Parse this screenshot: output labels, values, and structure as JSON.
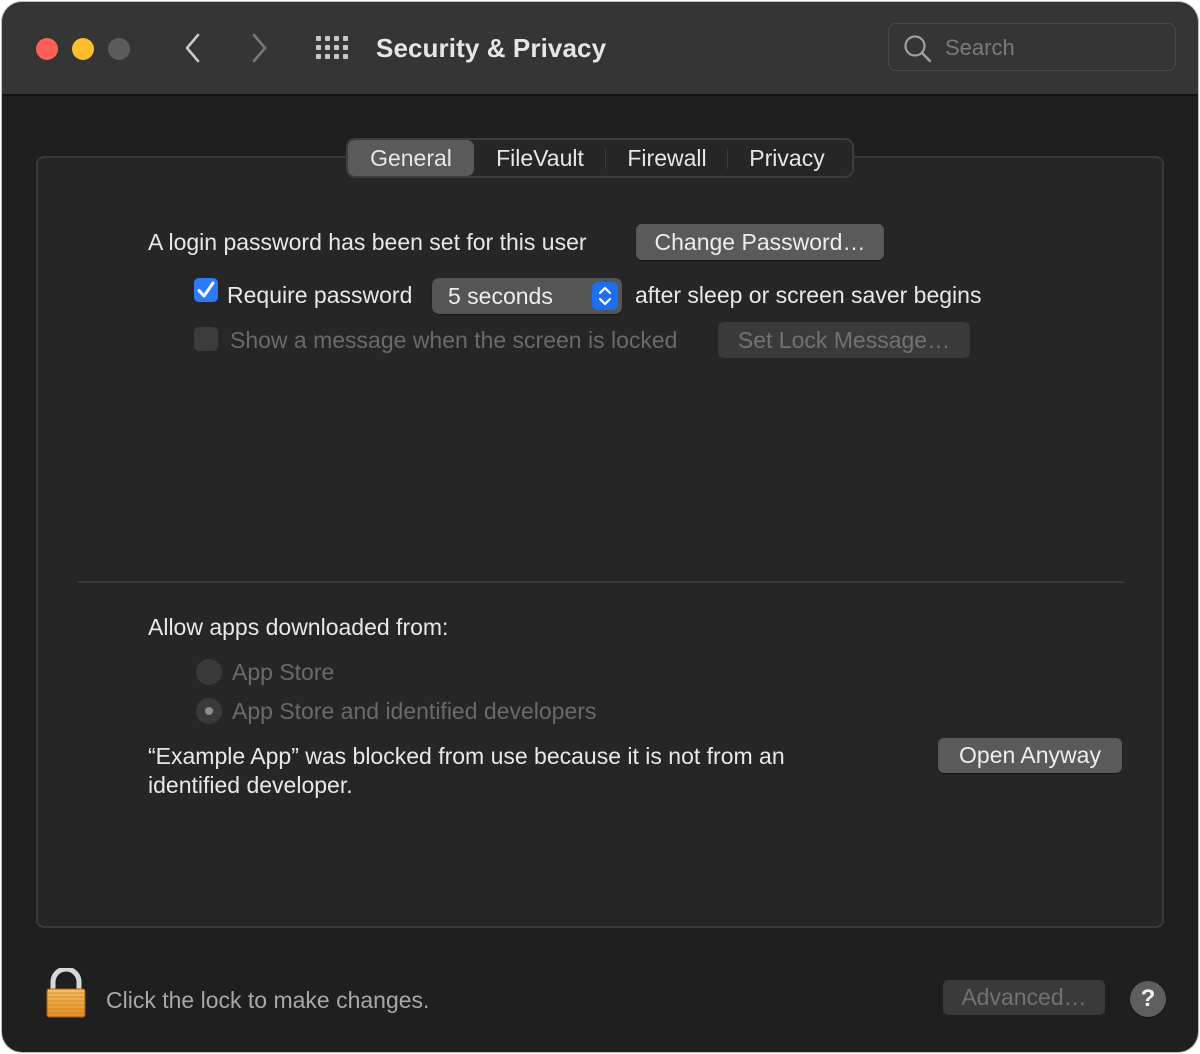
{
  "window": {
    "title": "Security & Privacy",
    "traffic_lights": [
      "close",
      "minimize",
      "zoom"
    ],
    "nav_icons": [
      "chevron-left-icon",
      "chevron-right-icon",
      "grid-icon"
    ],
    "search": {
      "placeholder": "Search",
      "value": ""
    }
  },
  "tabs": [
    {
      "label": "General",
      "active": true
    },
    {
      "label": "FileVault",
      "active": false
    },
    {
      "label": "Firewall",
      "active": false
    },
    {
      "label": "Privacy",
      "active": false
    }
  ],
  "general": {
    "login_text": "A login password has been set for this user",
    "change_password_label": "Change Password…",
    "require_password": {
      "label": "Require password",
      "checked": true
    },
    "delay_select": {
      "value": "5 seconds"
    },
    "after_text": "after sleep or screen saver begins",
    "show_message": {
      "label": "Show a message when the screen is locked",
      "checked": false,
      "disabled": true
    },
    "set_lock_message_label": "Set Lock Message…"
  },
  "apps": {
    "heading": "Allow apps downloaded from:",
    "options": [
      {
        "label": "App Store",
        "selected": false,
        "disabled": true
      },
      {
        "label": "App Store and identified developers",
        "selected": true,
        "disabled": true
      }
    ],
    "blocked_line1": "“Example App” was blocked from use because it is not from an",
    "blocked_line2": "identified developer.",
    "open_anyway_label": "Open Anyway"
  },
  "footer": {
    "lock_text": "Click the lock to make changes.",
    "advanced_label": "Advanced…",
    "help_label": "?"
  },
  "colors": {
    "accent": "#2d7bf6",
    "close": "#fe5f57",
    "minimize": "#febc2e",
    "zoom_inactive": "#5c5c5c",
    "lock_body": "#f0a53c"
  }
}
